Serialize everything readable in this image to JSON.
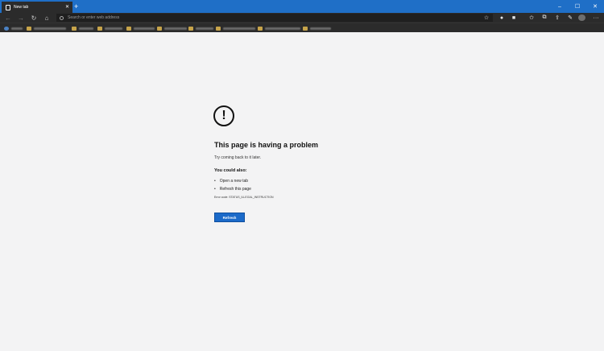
{
  "tabs": [
    {
      "label": "New tab",
      "active": true
    }
  ],
  "new_tab_symbol": "+",
  "window_controls": {
    "minimize": "–",
    "maximize": "☐",
    "close": "✕"
  },
  "toolbar": {
    "back_icon": "back-arrow-icon",
    "forward_icon": "forward-arrow-icon",
    "refresh_icon": "refresh-icon",
    "home_icon": "home-icon",
    "address_placeholder": "Search or enter web address"
  },
  "error_page": {
    "title": "This page is having a problem",
    "subtitle": "Try coming back to it later.",
    "could_also": "You could also:",
    "options": [
      "Open a new tab",
      "Refresh this page"
    ],
    "error_code": "Error code: STATUS_ILLEGAL_INSTRUCTION",
    "refresh_button": "Refresh"
  },
  "colors": {
    "titlebar": "#1f6fc7",
    "toolbar": "#2b2b2b",
    "page_bg": "#f3f3f4",
    "button": "#1b6ac9"
  }
}
